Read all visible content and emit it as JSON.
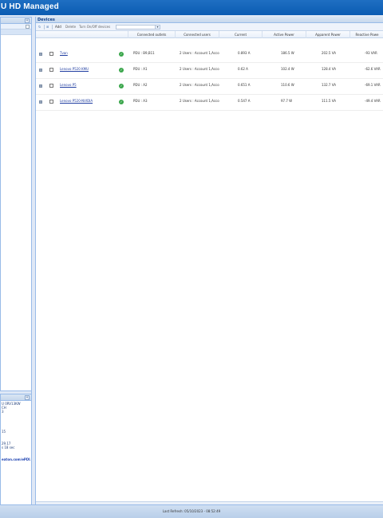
{
  "banner": {
    "title": "U HD Managed"
  },
  "left_top": {
    "collapse": "«"
  },
  "left_bottom": {
    "collapse": "«",
    "lines": [
      "U 0RV13KW",
      "CH",
      "3"
    ],
    "lines2": [
      "15"
    ],
    "lines3": [
      "29.17",
      "s 18 sec"
    ],
    "link": "eaton.com/ePDU"
  },
  "devices": {
    "header": "Devices",
    "toolbar": {
      "add": "Add",
      "delete": "Delete",
      "turn_on_off": "Turn On/Off devices"
    },
    "columns": [
      "Connected outlets",
      "Connected users",
      "Current",
      "Active Power",
      "Apparent Power",
      "Reactive Powe"
    ],
    "rows": [
      {
        "name": "Tvan",
        "outlets": "PDU : B9,B11",
        "users": "2 Users : Account 1,Acco",
        "current": "0.893 A",
        "active": "186.5 W",
        "apparent": "202.5 VA",
        "reactive": "-93 VAR"
      },
      {
        "name": "Lenovo P520 KMU",
        "outlets": "PDU : A1",
        "users": "2 Users : Account 1,Acco",
        "current": "0.62 A",
        "active": "102.4 W",
        "apparent": "128.4 VA",
        "reactive": "-62.6 VAR"
      },
      {
        "name": "Lenovo P5",
        "outlets": "PDU : A2",
        "users": "2 Users : Account 1,Acco",
        "current": "0.651 A",
        "active": "110.6 W",
        "apparent": "132.7 VA",
        "reactive": "-69.1 VAR"
      },
      {
        "name": "Lenovo P520-NVIDIA",
        "outlets": "PDU : A3",
        "users": "2 Users : Account 1,Acco",
        "current": "0.547 A",
        "active": "97.7 W",
        "apparent": "111.5 VA",
        "reactive": "-49.4 VAR"
      }
    ]
  },
  "footer": {
    "refresh": "Last Refresh: 05/10/2023 - 08:52:49"
  }
}
